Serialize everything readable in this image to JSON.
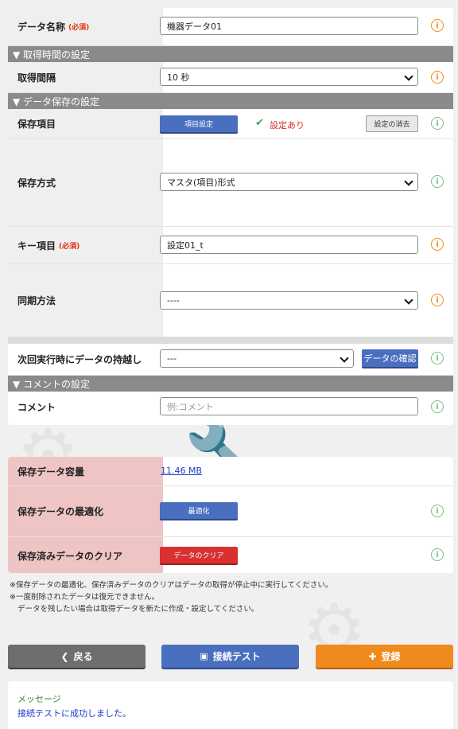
{
  "form": {
    "data_name_label": "データ名称",
    "required_label": "(必須)",
    "data_name_value": "機器データ01",
    "section_acquire": "▼ 取得時間の設定",
    "interval_label": "取得間隔",
    "interval_value": "10 秒",
    "section_save": "▼ データ保存の設定",
    "save_items_label": "保存項目",
    "item_settings_button": "項目設定",
    "setting_status": "設定あり",
    "clear_settings_button": "設定の消去",
    "save_method_label": "保存方式",
    "save_method_value": "マスタ(項目)形式",
    "key_item_label": "キー項目",
    "key_item_value": "設定01_t",
    "sync_method_label": "同期方法",
    "sync_method_value": "----",
    "carry_over_label": "次回実行時にデータの持越し",
    "carry_over_value": "---",
    "check_data_button": "データの確認",
    "section_comment": "▼ コメントの設定",
    "comment_label": "コメント",
    "comment_placeholder": "例:コメント"
  },
  "storage": {
    "capacity_label": "保存データ容量",
    "capacity_value": "11.46 MB",
    "optimize_label": "保存データの最適化",
    "optimize_button": "最適化",
    "clear_label": "保存済みデータのクリア",
    "clear_button": "データのクリア"
  },
  "notes": [
    "※保存データの最適化、保存済みデータのクリアはデータの取得が停止中に実行してください。",
    "※一度削除されたデータは復元できません。",
    "データを残したい場合は取得データを新たに作成・設定してください。"
  ],
  "actions": {
    "back": "戻る",
    "test": "接続テスト",
    "register": "登録"
  },
  "message": {
    "title": "メッセージ",
    "text": "接続テストに成功しました。"
  },
  "colors": {
    "warn": "#f08c1e",
    "info": "#7bbf7b",
    "primary": "#4a6fbf",
    "danger": "#d93030",
    "back": "#6e6e6e",
    "register": "#ef8a1f",
    "storage_label_bg": "#efc4c4"
  },
  "icons": {
    "required_hint": "warning-circle-icon",
    "info": "info-circle-icon",
    "check": "check-icon",
    "back": "chevron-left-icon",
    "test": "network-icon",
    "register": "user-plus-icon"
  }
}
